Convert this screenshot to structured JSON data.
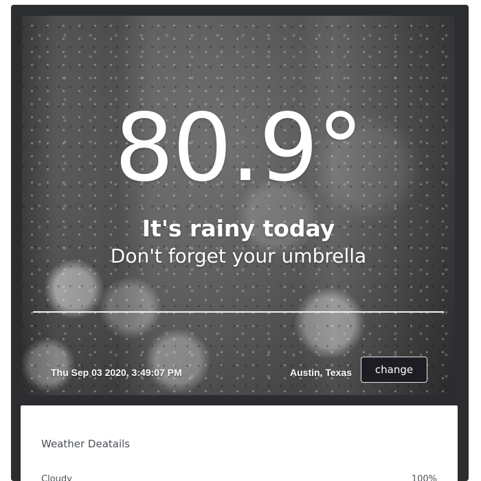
{
  "hero": {
    "temperature": "80.9°",
    "condition": "It's rainy today",
    "advice": "Don't forget your umbrella",
    "datetime": "Thu Sep 03 2020, 3:49:07 PM",
    "location": "Austin, Texas",
    "change_label": "change",
    "background_image": "rain-drops-on-glass"
  },
  "details": {
    "title": "Weather Deatails",
    "rows": [
      {
        "label": "Cloudy",
        "value": "100%"
      }
    ]
  },
  "colors": {
    "frame": "#2b2d31",
    "button_bg": "#1d1e23",
    "text_dark": "#4a4f57"
  }
}
